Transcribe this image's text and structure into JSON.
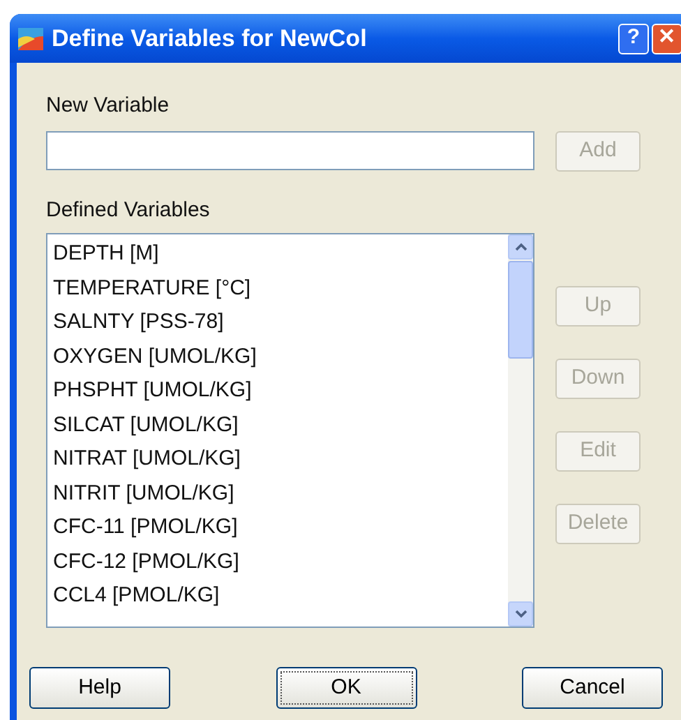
{
  "window": {
    "title": "Define Variables for NewCol",
    "title_buttons": [
      {
        "kind": "help",
        "label": "?"
      },
      {
        "kind": "close",
        "label": "✕"
      }
    ]
  },
  "new_variable": {
    "label": "New Variable",
    "add_button": {
      "label": "Add",
      "disabled": true
    }
  },
  "defined_variables": {
    "label": "Defined Variables",
    "items": [
      "DEPTH [M]",
      "TEMPERATURE [°C]",
      "SALNTY [PSS-78]",
      "OXYGEN [UMOL/KG]",
      "PHSPHT [UMOL/KG]",
      "SILCAT [UMOL/KG]",
      "NITRAT [UMOL/KG]",
      "NITRIT [UMOL/KG]",
      "CFC-11 [PMOL/KG]",
      "CFC-12 [PMOL/KG]",
      "CCL4 [PMOL/KG]"
    ]
  },
  "side_buttons": [
    {
      "label": "Up",
      "disabled": true
    },
    {
      "label": "Down",
      "disabled": true
    },
    {
      "label": "Edit",
      "disabled": true
    },
    {
      "label": "Delete",
      "disabled": true
    }
  ],
  "footer_buttons": [
    {
      "label": "Help",
      "disabled": false,
      "default": false
    },
    {
      "label": "OK",
      "disabled": false,
      "default": true
    },
    {
      "label": "Cancel",
      "disabled": false,
      "default": false
    }
  ]
}
